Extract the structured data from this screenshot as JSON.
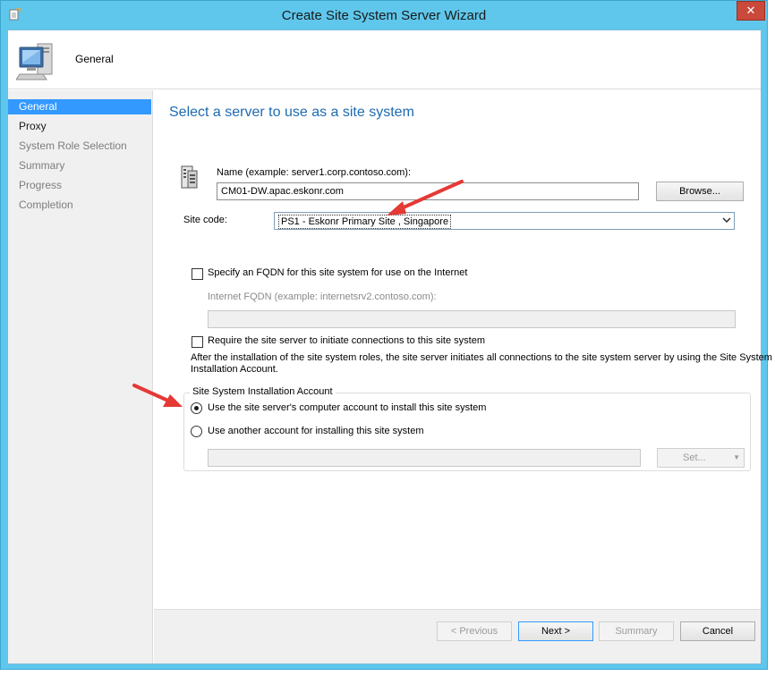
{
  "window": {
    "title": "Create Site System Server Wizard",
    "close_label": "✕"
  },
  "header": {
    "title": "General"
  },
  "nav": {
    "items": [
      {
        "label": "General",
        "state": "active"
      },
      {
        "label": "Proxy",
        "state": "bold"
      },
      {
        "label": "System Role Selection",
        "state": "normal"
      },
      {
        "label": "Summary",
        "state": "normal"
      },
      {
        "label": "Progress",
        "state": "normal"
      },
      {
        "label": "Completion",
        "state": "normal"
      }
    ]
  },
  "main": {
    "page_title": "Select a server to use as a site system",
    "name_label": "Name (example: server1.corp.contoso.com):",
    "name_value": "CM01-DW.apac.eskonr.com",
    "browse_label": "Browse...",
    "site_code_label": "Site code:",
    "site_code_value": "PS1 - Eskonr Primary Site , Singapore",
    "fqdn_checkbox_label": "Specify an FQDN for this site system for use on the Internet",
    "fqdn_field_label": "Internet FQDN (example: internetsrv2.contoso.com):",
    "fqdn_value": "",
    "require_checkbox_label": "Require the site server to initiate connections to this site system",
    "require_note_line1": "After the  installation of the site system roles, the site server initiates all connections to the site system server by using the Site System",
    "require_note_line2": "Installation Account.",
    "group_title": "Site System Installation Account",
    "radio_computer_label": "Use the site server's computer account to install this site system",
    "radio_another_label": "Use another account for installing this site system",
    "account_value": "",
    "set_label": "Set...",
    "set_arrow": "▼"
  },
  "footer": {
    "previous_label": "< Previous",
    "next_label": "Next >",
    "summary_label": "Summary",
    "cancel_label": "Cancel"
  },
  "colors": {
    "title_bar": "#5fc7ec",
    "accent_blue": "#3399ff",
    "title_text": "#1e6bb0",
    "arrow_red": "#e53935",
    "close_red": "#c9493a"
  }
}
